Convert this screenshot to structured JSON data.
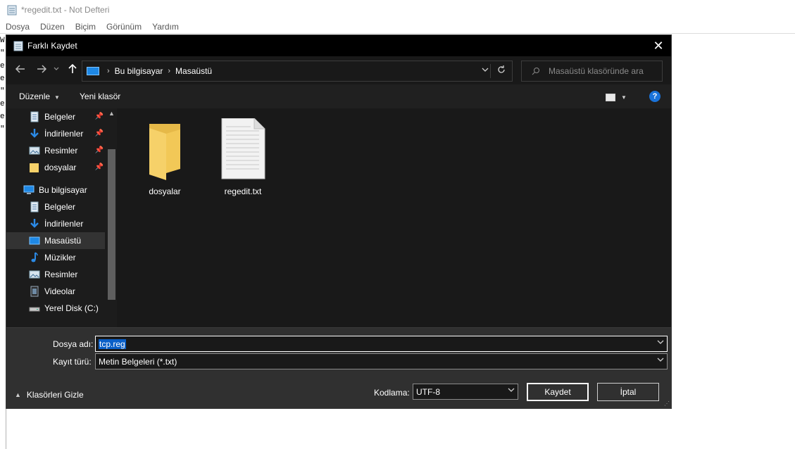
{
  "notepad": {
    "title": "*regedit.txt - Not Defteri",
    "menu": [
      "Dosya",
      "Düzen",
      "Biçim",
      "Görünüm",
      "Yardım"
    ],
    "visible_chars": [
      "W",
      "",
      "\"",
      "e",
      "e",
      "\"",
      "",
      "e",
      "e",
      "\""
    ]
  },
  "dialog": {
    "title": "Farklı Kaydet",
    "close_glyph": "✕",
    "address": {
      "segments": [
        "Bu bilgisayar",
        "Masaüstü"
      ],
      "separator": "›"
    },
    "search_placeholder": "Masaüstü klasöründe ara",
    "toolbar": {
      "organize": "Düzenle",
      "new_folder": "Yeni klasör",
      "help": "?"
    },
    "navigation": {
      "quick_access": [
        {
          "label": "Belgeler",
          "icon": "documents-icon",
          "pinned": true
        },
        {
          "label": "İndirilenler",
          "icon": "downloads-icon",
          "pinned": true
        },
        {
          "label": "Resimler",
          "icon": "pictures-icon",
          "pinned": true
        },
        {
          "label": "dosyalar",
          "icon": "folder-icon",
          "pinned": true
        }
      ],
      "this_pc": {
        "label": "Bu bilgisayar",
        "icon": "computer-icon"
      },
      "pc_items": [
        {
          "label": "Belgeler",
          "icon": "documents-icon",
          "selected": false
        },
        {
          "label": "İndirilenler",
          "icon": "downloads-icon",
          "selected": false
        },
        {
          "label": "Masaüstü",
          "icon": "desktop-icon",
          "selected": true
        },
        {
          "label": "Müzikler",
          "icon": "music-icon",
          "selected": false
        },
        {
          "label": "Resimler",
          "icon": "pictures-icon",
          "selected": false
        },
        {
          "label": "Videolar",
          "icon": "videos-icon",
          "selected": false
        },
        {
          "label": "Yerel Disk (C:)",
          "icon": "drive-icon",
          "selected": false
        }
      ]
    },
    "files": [
      {
        "name": "dosyalar",
        "type": "folder"
      },
      {
        "name": "regedit.txt",
        "type": "text-file"
      }
    ],
    "filename_label": "Dosya adı:",
    "filename_value": "tcp.reg",
    "filetype_label": "Kayıt türü:",
    "filetype_value": "Metin Belgeleri (*.txt)",
    "encoding_label": "Kodlama:",
    "encoding_value": "UTF-8",
    "hide_folders": "Klasörleri Gizle",
    "save_button": "Kaydet",
    "cancel_button": "İptal"
  },
  "colors": {
    "dialog_bg": "#202020",
    "titlebar_bg": "#000000",
    "selection_blue": "#0a5fc7",
    "accent_blue": "#1e88e5",
    "folder_yellow": "#f6d169"
  }
}
